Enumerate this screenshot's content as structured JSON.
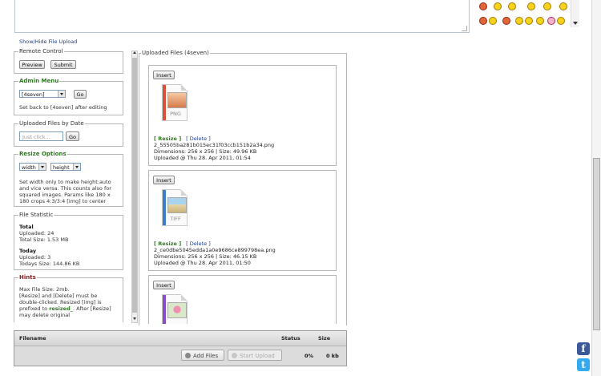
{
  "top": {
    "show_hide_link": "Show/Hide File Upload"
  },
  "colors": {
    "link": "#1d3e8a",
    "green": "#2d7a1f",
    "hints": "#8c1c1c",
    "facebook": "#3b5998",
    "twitter": "#33aaf0"
  },
  "remote_control": {
    "legend": "Remote Control",
    "preview_label": "Preview",
    "submit_label": "Submit"
  },
  "admin_menu": {
    "legend": "Admin Menu",
    "select_value": "[4seven]",
    "go_label": "Go",
    "note": "Set back to [4seven] after editing"
  },
  "uploaded_by_date": {
    "legend": "Uploaded Files by Date",
    "placeholder": "Just click...",
    "go_label": "Go"
  },
  "resize_options": {
    "legend": "Resize Options",
    "width_value": "width",
    "height_value": "height",
    "help": [
      "Set width only to make height:auto",
      "and vice versa. This counts also for",
      "squared images. Params like 180 x",
      "180 crops 4:3/3:4 [img] to center"
    ]
  },
  "file_statistic": {
    "legend": "File Statistic",
    "total_heading": "Total",
    "total_uploaded": "Uploaded: 24",
    "total_size": "Total Size: 1.53 MB",
    "today_heading": "Today",
    "today_uploaded": "Uploaded: 3",
    "today_size": "Todays Size: 144.86 KB"
  },
  "hints": {
    "legend": "Hints",
    "line1": "Max File Size: 2mb.",
    "line2": "[Resize] and [Delete] must be",
    "line3": "double-clicked. Resized [img] is",
    "line4_prefix": "prefixed to ",
    "line4_bold": "resized_",
    "line4_suffix": ". After [Resize]",
    "line5": "may delete original"
  },
  "uploaded_files": {
    "legend": "Uploaded Files (4seven)",
    "files": [
      {
        "insert_label": "Insert",
        "ext": "PNG",
        "resize_label": "[ Resize ]",
        "delete_label": "[ Delete ]",
        "filename": "2_55505ba281b015ec31f03ccb151b2a34.png",
        "dimensions": "Dimensions: 256 x 256 | Size: 49.96 KB",
        "uploaded": "Uploaded @ Thu 28. Apr 2011, 01:54"
      },
      {
        "insert_label": "Insert",
        "ext": "TIFF",
        "resize_label": "[ Resize ]",
        "delete_label": "[ Delete ]",
        "filename": "2_ce0dbe5045edda1a0e9686ce899798ea.png",
        "dimensions": "Dimensions: 256 x 256 | Size: 46.15 KB",
        "uploaded": "Uploaded @ Thu 28. Apr 2011, 01:50"
      },
      {
        "insert_label": "Insert"
      }
    ]
  },
  "upload_table": {
    "col_filename": "Filename",
    "col_status": "Status",
    "col_size": "Size",
    "add_files_label": "Add Files",
    "start_upload_label": "Start Upload",
    "status_value": "0%",
    "size_value": "0 kb"
  }
}
